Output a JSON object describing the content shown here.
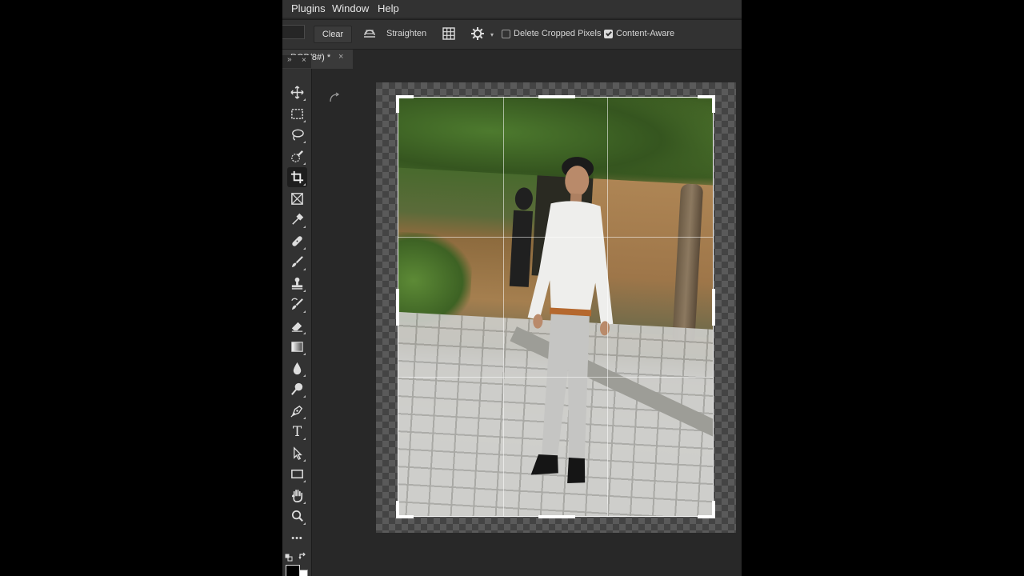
{
  "menu": {
    "plugins": "Plugins",
    "window": "Window",
    "help": "Help"
  },
  "options": {
    "clear_label": "Clear",
    "straighten_label": "Straighten",
    "delete_cropped_label": "Delete Cropped Pixels",
    "delete_cropped_checked": false,
    "content_aware_label": "Content-Aware",
    "content_aware_checked": true
  },
  "document": {
    "tab_label": "RGB/8#) *",
    "close_glyph": "×"
  },
  "panel": {
    "collapse_glyph": "»",
    "close_glyph": "×"
  },
  "toolbar": {
    "tools": [
      {
        "name": "move-tool",
        "icon": "move-icon"
      },
      {
        "name": "marquee-tool",
        "icon": "rectangular-marquee-icon"
      },
      {
        "name": "lasso-tool",
        "icon": "lasso-icon"
      },
      {
        "name": "quick-selection-tool",
        "icon": "quick-selection-icon"
      },
      {
        "name": "crop-tool",
        "icon": "crop-icon",
        "active": true
      },
      {
        "name": "frame-tool",
        "icon": "frame-icon"
      },
      {
        "name": "eyedropper-tool",
        "icon": "eyedropper-icon"
      },
      {
        "name": "healing-brush-tool",
        "icon": "bandage-icon"
      },
      {
        "name": "brush-tool",
        "icon": "brush-icon"
      },
      {
        "name": "clone-stamp-tool",
        "icon": "stamp-icon"
      },
      {
        "name": "history-brush-tool",
        "icon": "history-brush-icon"
      },
      {
        "name": "eraser-tool",
        "icon": "eraser-icon"
      },
      {
        "name": "gradient-tool",
        "icon": "gradient-icon"
      },
      {
        "name": "blur-tool",
        "icon": "drop-icon"
      },
      {
        "name": "dodge-tool",
        "icon": "dodge-icon"
      },
      {
        "name": "pen-tool",
        "icon": "pen-icon"
      },
      {
        "name": "type-tool",
        "icon": "type-icon",
        "glyph": "T"
      },
      {
        "name": "path-selection-tool",
        "icon": "arrow-icon"
      },
      {
        "name": "rectangle-tool",
        "icon": "rectangle-icon"
      },
      {
        "name": "hand-tool",
        "icon": "hand-icon"
      },
      {
        "name": "zoom-tool",
        "icon": "magnifier-icon"
      },
      {
        "name": "more-tools",
        "icon": "ellipsis-icon",
        "glyph": "•••"
      }
    ],
    "colors": {
      "foreground": "#000000",
      "background": "#ffffff"
    }
  }
}
